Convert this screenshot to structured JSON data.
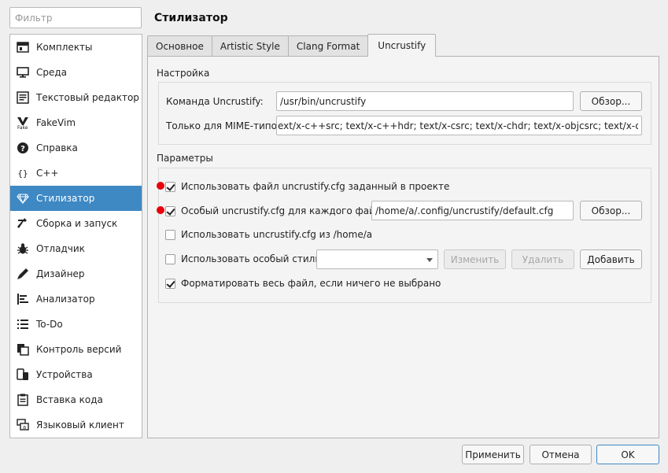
{
  "filter": {
    "placeholder": "Фильтр"
  },
  "sidebar": {
    "items": [
      {
        "label": "Комплекты",
        "icon": "kits-icon"
      },
      {
        "label": "Среда",
        "icon": "monitor-icon"
      },
      {
        "label": "Текстовый редактор",
        "icon": "text-editor-icon"
      },
      {
        "label": "FakeVim",
        "icon": "fakevim-icon"
      },
      {
        "label": "Справка",
        "icon": "help-icon"
      },
      {
        "label": "C++",
        "icon": "braces-icon"
      },
      {
        "label": "Стилизатор",
        "icon": "diamond-icon",
        "active": true
      },
      {
        "label": "Сборка и запуск",
        "icon": "hammer-icon"
      },
      {
        "label": "Отладчик",
        "icon": "bug-icon"
      },
      {
        "label": "Дизайнер",
        "icon": "pen-icon"
      },
      {
        "label": "Анализатор",
        "icon": "analyzer-icon"
      },
      {
        "label": "To-Do",
        "icon": "todo-list-icon"
      },
      {
        "label": "Контроль версий",
        "icon": "version-control-icon"
      },
      {
        "label": "Устройства",
        "icon": "devices-icon"
      },
      {
        "label": "Вставка кода",
        "icon": "code-paste-icon"
      },
      {
        "label": "Языковый клиент",
        "icon": "language-client-icon"
      }
    ]
  },
  "page_title": "Стилизатор",
  "tabs": [
    {
      "label": "Основное"
    },
    {
      "label": "Artistic Style"
    },
    {
      "label": "Clang Format"
    },
    {
      "label": "Uncrustify",
      "active": true
    }
  ],
  "config": {
    "title": "Настройка",
    "command_label": "Команда Uncrustify:",
    "command_value": "/usr/bin/uncrustify",
    "browse_label": "Обзор...",
    "mime_label": "Только для MIME-типов:",
    "mime_value": "ext/x-c++src; text/x-c++hdr; text/x-csrc; text/x-chdr; text/x-objcsrc; text/x-objc++src"
  },
  "options": {
    "title": "Параметры",
    "use_project_cfg": {
      "label": "Использовать файл uncrustify.cfg заданный в проекте",
      "checked": true
    },
    "per_file_cfg": {
      "label": "Особый uncrustify.cfg для каждого файла",
      "checked": true,
      "value": "/home/a/.config/uncrustify/default.cfg",
      "browse_label": "Обзор..."
    },
    "home_cfg": {
      "label": "Использовать uncrustify.cfg из /home/a",
      "checked": false
    },
    "custom_style": {
      "label": "Использовать особый стиль:",
      "checked": false,
      "edit_label": "Изменить",
      "remove_label": "Удалить",
      "add_label": "Добавить"
    },
    "format_whole": {
      "label": "Форматировать весь файл, если ничего не выбрано",
      "checked": true
    }
  },
  "footer": {
    "apply_label": "Применить",
    "cancel_label": "Отмена",
    "ok_label": "OK"
  },
  "colors": {
    "accent": "#3e88c3",
    "marker": "#e8000b"
  }
}
